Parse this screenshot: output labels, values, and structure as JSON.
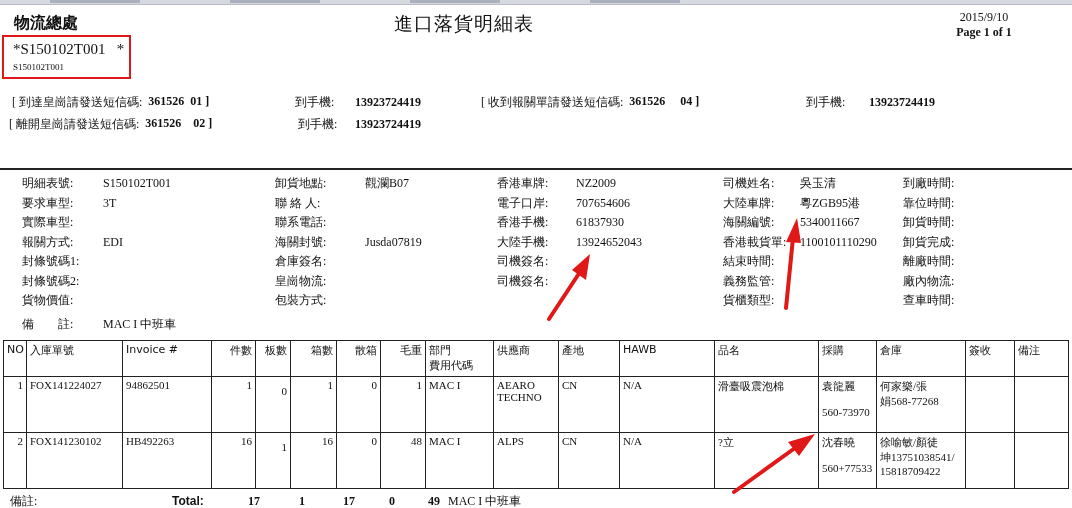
{
  "header": {
    "org": "物流總處",
    "title": "進口落貨明細表",
    "date": "2015/9/10",
    "page": "Page 1 of 1"
  },
  "barcode": {
    "code": "*S150102T001   *",
    "caption": "S150102T001"
  },
  "sms": [
    {
      "label": "[ 到達皇崗請發送短信碼:",
      "code": "361526  01 ]",
      "phone_label": "到手機:",
      "phone": "13923724419"
    },
    {
      "label": "[ 收到報關單請發送短信碼:",
      "code": "361526     04 ]",
      "phone_label": "到手機:",
      "phone": "13923724419"
    },
    {
      "label": "[ 離開皇崗請發送短信碼:",
      "code": "361526    02 ]",
      "phone_label": "到手機:",
      "phone": "13923724419"
    }
  ],
  "info_columns": [
    [
      {
        "label": "明細表號:",
        "value": "S150102T001"
      },
      {
        "label": "要求車型:",
        "value": "3T"
      },
      {
        "label": "實際車型:"
      },
      {
        "label": "報關方式:",
        "value": "EDI"
      },
      {
        "label": "封條號碼1:"
      },
      {
        "label": "封條號碼2:"
      },
      {
        "label": "貨物價值:"
      },
      {
        "label": "備　　註:",
        "value": "MAC I 中班車"
      }
    ],
    [
      {
        "label": "卸貨地點:",
        "value": "觀瀾B07"
      },
      {
        "label": "聯 絡 人:"
      },
      {
        "label": "聯系電話:"
      },
      {
        "label": "海關封號:",
        "value": "Jusda07819"
      },
      {
        "label": "倉庫簽名:"
      },
      {
        "label": "皇崗物流:"
      },
      {
        "label": "包裝方式:"
      }
    ],
    [
      {
        "label": "香港車牌:",
        "value": "NZ2009"
      },
      {
        "label": "電子口岸:",
        "value": "707654606"
      },
      {
        "label": "香港手機:",
        "value": "61837930"
      },
      {
        "label": "大陸手機:",
        "value": "13924652043"
      },
      {
        "label": "司機簽名:"
      },
      {
        "label": "司機簽名:"
      }
    ],
    [
      {
        "label": "司機姓名:",
        "value": "吳玉清"
      },
      {
        "label": "大陸車牌:",
        "value": "粵ZGB95港"
      },
      {
        "label": "海關編號:",
        "value": "5340011667"
      },
      {
        "label": "香港載貨單:",
        "value": "1100101110290"
      },
      {
        "label": "結束時間:"
      },
      {
        "label": "義務監管:"
      },
      {
        "label": "貨櫃類型:"
      }
    ],
    [
      {
        "label": "到廠時間:"
      },
      {
        "label": "靠位時間:"
      },
      {
        "label": "卸貨時間:"
      },
      {
        "label": "卸貨完成:"
      },
      {
        "label": "離廠時間:"
      },
      {
        "label": "廠內物流:"
      },
      {
        "label": "查車時間:"
      }
    ]
  ],
  "table": {
    "columns": [
      "NO",
      "入庫單號",
      "Invoice #",
      "件數",
      "板數",
      "箱數",
      "散箱",
      "毛重",
      [
        "部門",
        "費用代碼"
      ],
      "供應商",
      "產地",
      "HAWB",
      "品名",
      "採購",
      "倉庫",
      "簽收",
      "備注"
    ],
    "rows": [
      [
        "1",
        "FOX141224027",
        "94862501",
        "1",
        "0",
        "1",
        "0",
        "1",
        "MAC I",
        "AEARO\nTECHNO",
        "CN",
        "N/A",
        "滑臺吸震泡棉",
        "袁龍麗\n\n560-73970",
        [
          "何家樂/張",
          "娟568-77268"
        ]
      ],
      [
        "2",
        "FOX141230102",
        "HB492263",
        "16",
        "1",
        "16",
        "0",
        "48",
        "MAC I",
        "ALPS",
        "CN",
        "N/A",
        "?立",
        "沈春曉\n\n560+77533",
        [
          "徐喻敏/顏徒",
          "坤13751038541/",
          "15818709422"
        ]
      ]
    ]
  },
  "totals": {
    "label": "備註:",
    "total_label": "Total:",
    "values": [
      "17",
      "1",
      "17",
      "0",
      "49"
    ],
    "note": "MAC I 中班車"
  }
}
